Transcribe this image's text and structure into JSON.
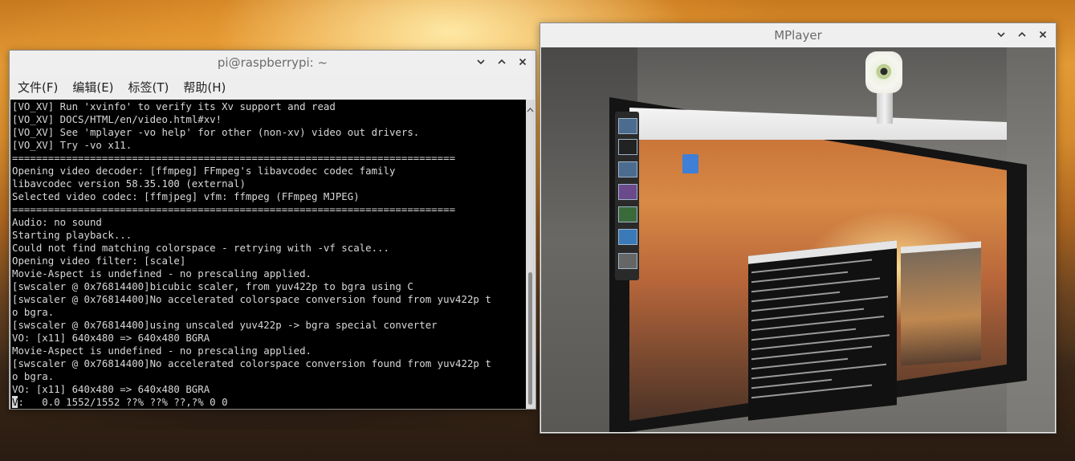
{
  "desktop": {
    "background": "sunset-hills-wallpaper"
  },
  "terminal": {
    "title": "pi@raspberrypi: ~",
    "menu": [
      "文件(F)",
      "编辑(E)",
      "标签(T)",
      "帮助(H)"
    ],
    "lines": [
      "[VO_XV] Run 'xvinfo' to verify its Xv support and read",
      "[VO_XV] DOCS/HTML/en/video.html#xv!",
      "[VO_XV] See 'mplayer -vo help' for other (non-xv) video out drivers.",
      "[VO_XV] Try -vo x11.",
      "==========================================================================",
      "Opening video decoder: [ffmpeg] FFmpeg's libavcodec codec family",
      "libavcodec version 58.35.100 (external)",
      "Selected video codec: [ffmjpeg] vfm: ffmpeg (FFmpeg MJPEG)",
      "==========================================================================",
      "Audio: no sound",
      "Starting playback...",
      "Could not find matching colorspace - retrying with -vf scale...",
      "Opening video filter: [scale]",
      "Movie-Aspect is undefined - no prescaling applied.",
      "[swscaler @ 0x76814400]bicubic scaler, from yuv422p to bgra using C",
      "[swscaler @ 0x76814400]No accelerated colorspace conversion found from yuv422p t",
      "o bgra.",
      "[swscaler @ 0x76814400]using unscaled yuv422p -> bgra special converter",
      "VO: [x11] 640x480 => 640x480 BGRA",
      "Movie-Aspect is undefined - no prescaling applied.",
      "[swscaler @ 0x76814400]No accelerated colorspace conversion found from yuv422p t",
      "o bgra.",
      "VO: [x11] 640x480 => 640x480 BGRA"
    ],
    "status_cursor": "V",
    "status_rest": ":   0.0 1552/1552 ??% ??% ??,?% 0 0",
    "controls": {
      "minimize_icon": "chevron-down-icon",
      "maximize_icon": "chevron-up-icon",
      "close_icon": "close-icon"
    }
  },
  "mplayer": {
    "title": "MPlayer",
    "video": "webcam-feed-of-monitor",
    "controls": {
      "minimize_icon": "chevron-down-icon",
      "maximize_icon": "chevron-up-icon",
      "close_icon": "close-icon"
    }
  },
  "colors": {
    "titlebar_bg": "#efefef",
    "terminal_bg": "#000000",
    "terminal_fg": "#d8d8d8",
    "title_text": "#6b6b6b"
  }
}
